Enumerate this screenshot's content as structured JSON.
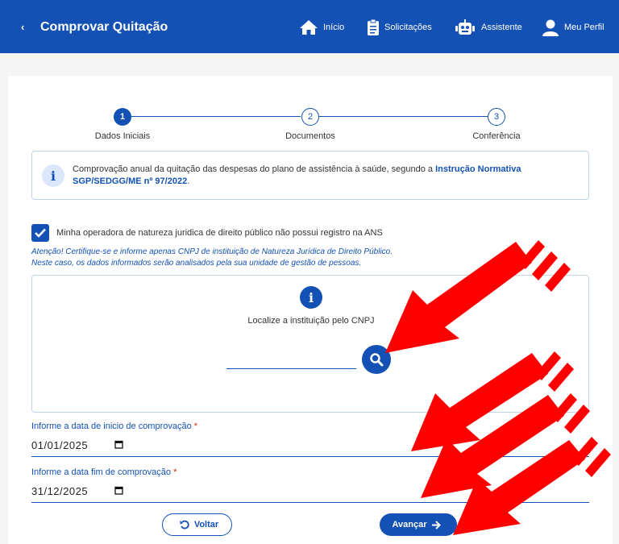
{
  "header": {
    "back_glyph": "‹",
    "title": "Comprovar Quitação",
    "nav": [
      {
        "label": "Início",
        "icon": "home-icon"
      },
      {
        "label": "Solicitações",
        "icon": "clipboard-icon"
      },
      {
        "label": "Assistente",
        "icon": "robot-icon"
      },
      {
        "label": "Meu Perfil",
        "icon": "user-icon"
      }
    ]
  },
  "stepper": {
    "steps": [
      {
        "number": "1",
        "label": "Dados Iniciais",
        "active": true
      },
      {
        "number": "2",
        "label": "Documentos",
        "active": false
      },
      {
        "number": "3",
        "label": "Conferência",
        "active": false
      }
    ]
  },
  "info": {
    "icon_glyph": "i",
    "text": "Comprovação anual da quitação das despesas do plano de assistência à saúde, segundo a ",
    "link": "Instrução Normativa SGP/SEDGG/ME nº 97/2022",
    "suffix": "."
  },
  "checkbox": {
    "checked": true,
    "label": "Minha operadora de natureza juridica de direito público não possui registro na ANS"
  },
  "warning": {
    "line1": "Atenção! Certifique-se e informe apenas CNPJ de instituição de Natureza Jurídica de Direito Público.",
    "line2": "Neste caso, os dados informados serão analisados pela sua unidade de gestão de pessoas."
  },
  "search": {
    "icon_glyph": "i",
    "hint": "Localize a instituição pelo CNPJ",
    "cnpj_value": ""
  },
  "dates": {
    "start_label": "Informe a data de inicio de comprovação",
    "start_value": "01/01/2025",
    "end_label": "Informe a data fim de comprovação",
    "end_value": "31/12/2025",
    "required_mark": "*"
  },
  "actions": {
    "back_label": "Voltar",
    "next_label": "Avançar"
  },
  "colors": {
    "primary": "#1351b4",
    "annotation_arrows": "#ff0000"
  }
}
